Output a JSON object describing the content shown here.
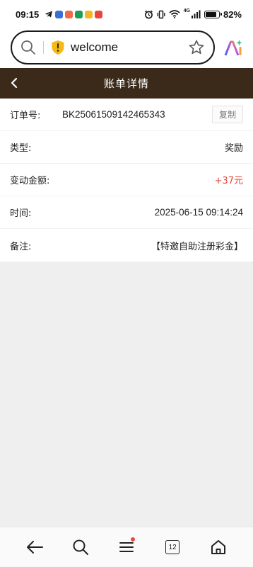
{
  "status_bar": {
    "time": "09:15",
    "battery_text": "82%",
    "battery_level": 0.82,
    "network": "4G"
  },
  "browser": {
    "url_text": "welcome"
  },
  "header": {
    "title": "账单详情"
  },
  "details": {
    "order_label": "订单号:",
    "order_value": "BK25061509142465343",
    "copy_label": "复制",
    "type_label": "类型:",
    "type_value": "奖励",
    "amount_label": "变动金额:",
    "amount_value": "+37元",
    "time_label": "时间:",
    "time_value": "2025-06-15 09:14:24",
    "note_label": "备注:",
    "note_value": "【特邀自助注册彩金】"
  },
  "bottom_nav": {
    "tab_count": "12"
  },
  "colors": {
    "header_bg": "#3b2a1a",
    "amount": "#e0463a"
  }
}
